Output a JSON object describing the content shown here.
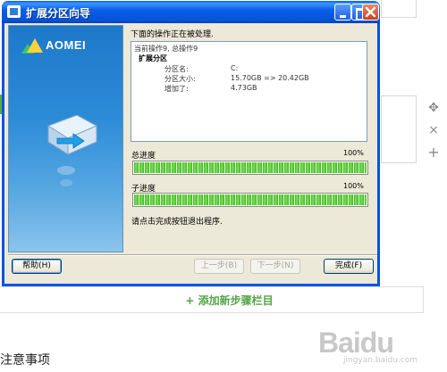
{
  "window": {
    "title": "扩展分区向导",
    "brand": "AOMEI",
    "status_heading": "下面的操作正在被处理.",
    "log": {
      "current_op": "当前操作9, 总操作9",
      "task": "扩展分区",
      "rows": [
        {
          "key": "分区名:",
          "value": "C:"
        },
        {
          "key": "分区大小:",
          "value": "15.70GB => 20.42GB"
        },
        {
          "key": "增加了:",
          "value": "4.73GB"
        }
      ]
    },
    "overall": {
      "label": "总进度",
      "percent_text": "100%",
      "progress": 1.0
    },
    "sub": {
      "label": "子进度",
      "percent_text": "100%",
      "progress": 1.0
    },
    "finish_hint": "请点击完成按钮退出程序.",
    "buttons": {
      "help": "帮助(H)",
      "prev": "上一步(B)",
      "next": "下一步(N)",
      "finish": "完成(F)"
    },
    "colors": {
      "progress": "#3fb820",
      "titlebar": "#0a5fe8"
    }
  },
  "page": {
    "add_step": "+ 添加新步骤栏目",
    "notes_heading": "注意事项",
    "watermark": "Baidu",
    "watermark_sub": "jingyan.baidu.com",
    "tools": {
      "move_icon": "✥",
      "close_icon": "×",
      "add_icon": "+"
    }
  }
}
